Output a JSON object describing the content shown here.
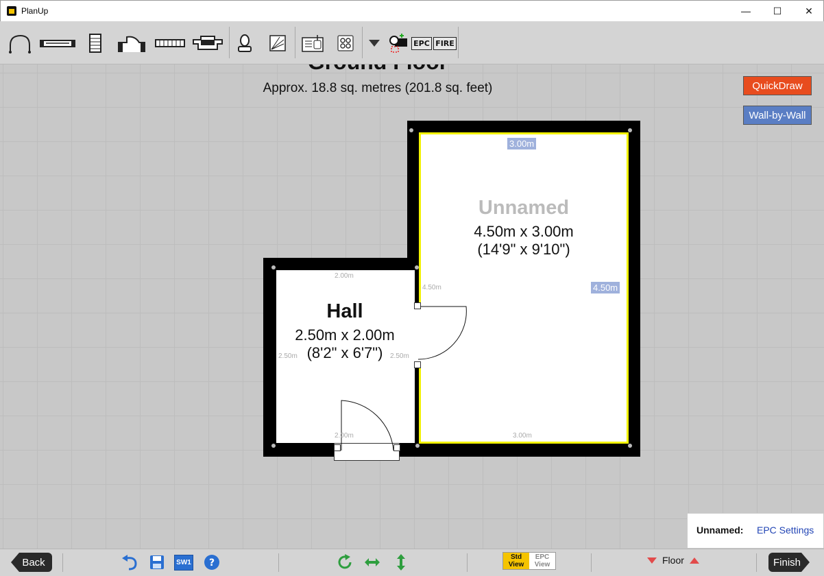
{
  "window": {
    "title": "PlanUp",
    "minimize": "—",
    "maximize": "☐",
    "close": "✕"
  },
  "toolbar": {
    "tools": [
      "door-tool",
      "window-tool",
      "stairs-tool",
      "opening-tool",
      "radiator-tool",
      "bay-tool",
      "boiler-tool",
      "label-tool",
      "sink-tool",
      "hob-tool"
    ],
    "epc_label": "EPC",
    "fire_label": "FIRE"
  },
  "plan": {
    "floor_title": "Ground Floor",
    "floor_area": "Approx. 18.8 sq. metres (201.8 sq. feet)",
    "quickdraw_label": "QuickDraw",
    "wallbywall_label": "Wall-by-Wall",
    "rooms": {
      "unnamed": {
        "name": "Unnamed",
        "dim_metric": "4.50m x 3.00m",
        "dim_imperial": "(14'9\" x 9'10\")",
        "top_dim": "3.00m",
        "right_dim": "4.50m",
        "left_dim": "4.50m",
        "bottom_dim": "3.00m"
      },
      "hall": {
        "name": "Hall",
        "dim_metric": "2.50m x 2.00m",
        "dim_imperial": "(8'2\" x 6'7\")",
        "top_dim": "2.00m",
        "left_dim": "2.50m",
        "right_dim": "2.50m",
        "bottom_dim": "2.00m"
      }
    }
  },
  "epc_panel": {
    "room_label": "Unnamed:",
    "link": "EPC Settings"
  },
  "bottombar": {
    "back_label": "Back",
    "finish_label": "Finish",
    "sw_label": "SW1",
    "std_view": [
      "Std",
      "View"
    ],
    "epc_view": [
      "EPC",
      "View"
    ],
    "floor_label": "Floor"
  },
  "colors": {
    "quickdraw": "#e84c1e",
    "wallbywall": "#5a7ec4",
    "selected_room": "#f2f200",
    "accent_green": "#2e9e3e",
    "accent_blue": "#2a6fd1"
  }
}
